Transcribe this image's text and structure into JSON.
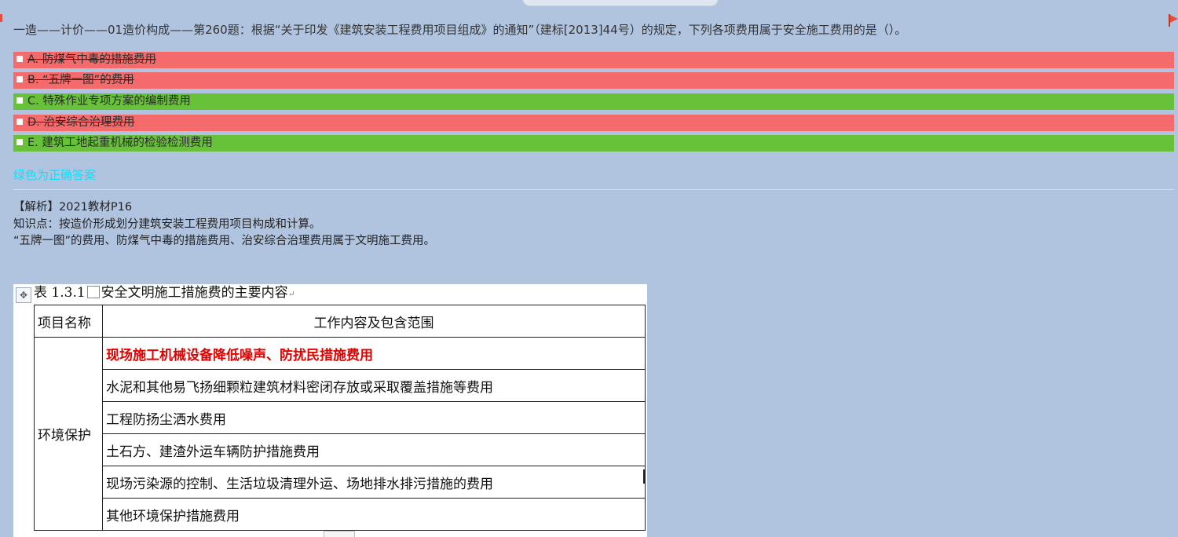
{
  "question": {
    "text": "一造——计价——01造价构成——第260题：根据“关于印发《建筑安装工程费用项目组成》的通知”（建标[2013]44号）的规定，下列各项费用属于安全施工费用的是（）。"
  },
  "options": [
    {
      "label": "A. 防煤气中毒的措施费用",
      "status": "wrong"
    },
    {
      "label": "B. “五牌一图”的费用",
      "status": "wrong"
    },
    {
      "label": "C. 特殊作业专项方案的编制费用",
      "status": "correct"
    },
    {
      "label": "D. 治安综合治理费用",
      "status": "wrong"
    },
    {
      "label": "E. 建筑工地起重机械的检验检测费用",
      "status": "correct"
    }
  ],
  "legend_note": "绿色为正确答案",
  "analysis": {
    "line1": "【解析】2021教材P16",
    "line2": "知识点：按造价形成划分建筑安装工程费用项目构成和计算。",
    "line3": "“五牌一图”的费用、防煤气中毒的措施费用、治安综合治理费用属于文明施工费用。"
  },
  "document": {
    "caption_a": "表 1.3.1",
    "caption_b": "安全文明施工措施费的主要内容",
    "header_col1": "项目名称",
    "header_col2": "工作内容及包含范围",
    "category": "环境保护",
    "rows": [
      "现场施工机械设备降低噪声、防扰民措施费用",
      "水泥和其他易飞扬细颗粒建筑材料密闭存放或采取覆盖措施等费用",
      "工程防扬尘洒水费用",
      "土石方、建渣外运车辆防护措施费用",
      "现场污染源的控制、生活垃圾清理外运、场地排水排污措施的费用",
      "其他环境保护措施费用"
    ]
  },
  "colors": {
    "background": "#b1c4df",
    "wrong": "#f56b6b",
    "correct": "#67c23a",
    "legend": "#00e5ff",
    "highlight_row": "#e00000"
  }
}
